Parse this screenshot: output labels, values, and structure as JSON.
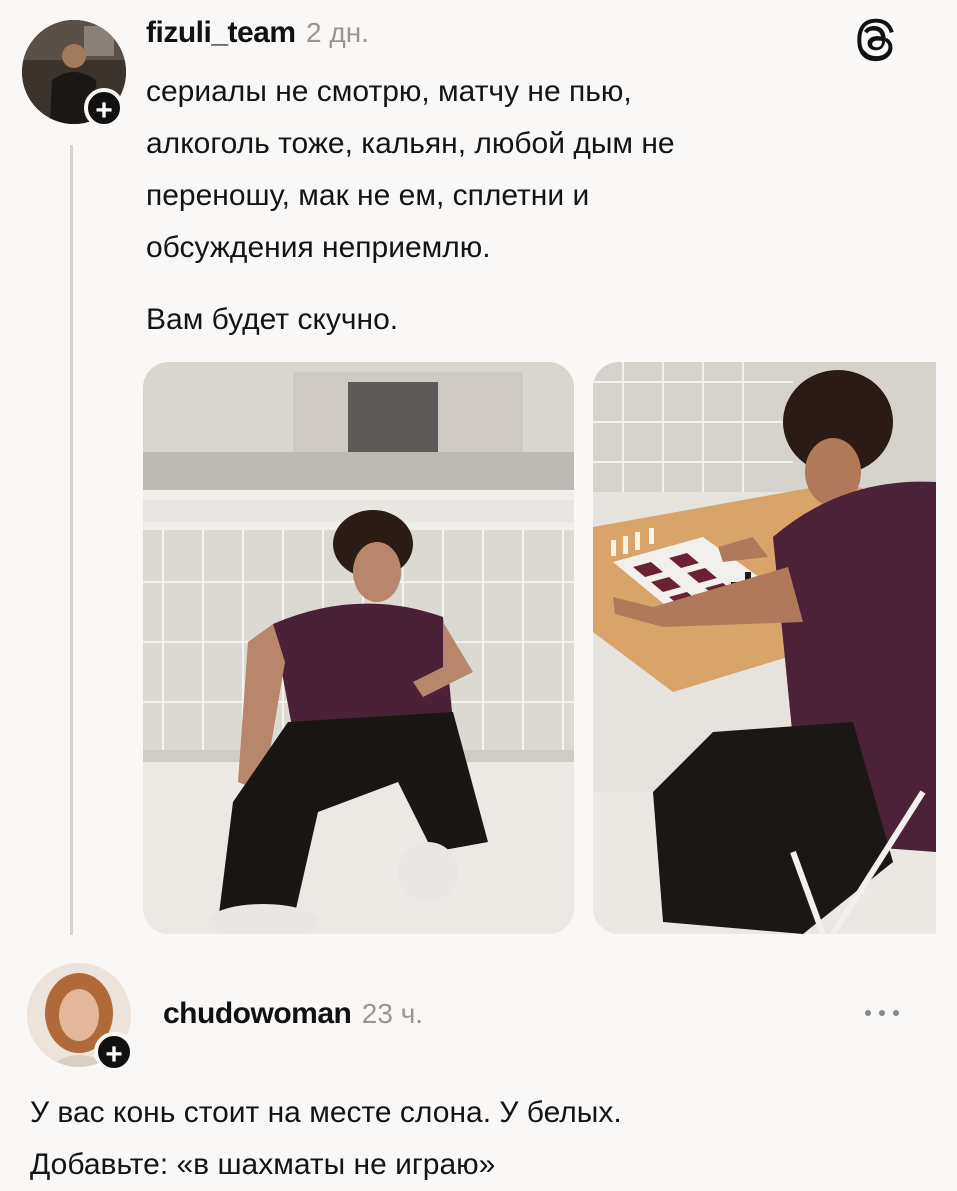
{
  "post": {
    "username": "fizuli_team",
    "time": "2 дн.",
    "text": "сериалы не смотрю, матчу не пью,\nалкоголь тоже, кальян, любой дым не\nпереношу, мак не ем, сплетни и\nобсуждения неприемлю.",
    "text_extra": "Вам будет скучно.",
    "follow_badge": "+",
    "avatar_icon": "user-avatar-photo",
    "brand_icon": "threads-logo-icon",
    "photos": [
      "man-sitting-on-floor-photo",
      "man-playing-chess-photo"
    ]
  },
  "reply": {
    "username": "chudowoman",
    "time": "23 ч.",
    "text": "У вас конь стоит на месте слона. У белых.\nДобавьте: «в шахматы не играю»",
    "follow_badge": "+",
    "avatar_icon": "user-avatar-photo",
    "more_icon": "more-options-icon"
  }
}
